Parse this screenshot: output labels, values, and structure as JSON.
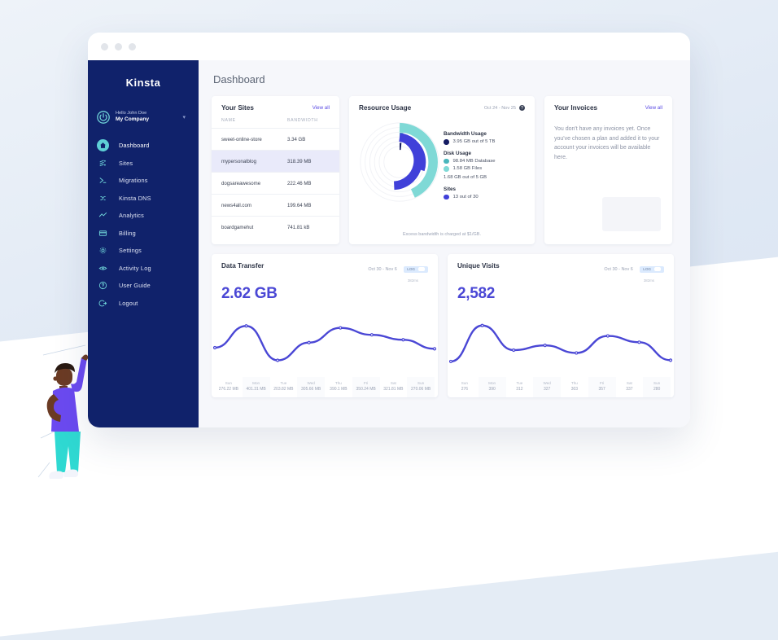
{
  "window": {
    "dots": 3
  },
  "sidebar": {
    "logo": "Kinsta",
    "profile": {
      "hello": "Hello John Doe",
      "company": "My Company",
      "chevron": "chevron-down-icon"
    },
    "items": [
      {
        "label": "Dashboard",
        "icon": "home-icon",
        "active": true
      },
      {
        "label": "Sites",
        "icon": "sites-icon",
        "active": false
      },
      {
        "label": "Migrations",
        "icon": "migrations-icon",
        "active": false
      },
      {
        "label": "Kinsta DNS",
        "icon": "dns-icon",
        "active": false
      },
      {
        "label": "Analytics",
        "icon": "analytics-icon",
        "active": false
      },
      {
        "label": "Billing",
        "icon": "billing-icon",
        "active": false
      },
      {
        "label": "Settings",
        "icon": "gear-icon",
        "active": false
      },
      {
        "label": "Activity Log",
        "icon": "eye-icon",
        "active": false
      },
      {
        "label": "User Guide",
        "icon": "help-icon",
        "active": false
      },
      {
        "label": "Logout",
        "icon": "logout-icon",
        "active": false
      }
    ]
  },
  "header": {
    "title": "Dashboard"
  },
  "sites_card": {
    "title": "Your Sites",
    "view_all": "View all",
    "columns": [
      "NAME",
      "BANDWIDTH"
    ],
    "rows": [
      {
        "name": "sweet-online-store",
        "bandwidth": "3.34 GB",
        "selected": false
      },
      {
        "name": "mypersonalblog",
        "bandwidth": "318.39 MB",
        "selected": true
      },
      {
        "name": "dogsareawesome",
        "bandwidth": "222.46 MB",
        "selected": false
      },
      {
        "name": "news4all.com",
        "bandwidth": "199.64 MB",
        "selected": false
      },
      {
        "name": "boardgamehut",
        "bandwidth": "741.81 kB",
        "selected": false
      }
    ]
  },
  "resource_card": {
    "title": "Resource Usage",
    "date_range": "Oct 24 - Nov 25",
    "info_icon": "question-mark-icon",
    "footer": "Excess bandwidth is charged at $1/GB.",
    "groups": [
      {
        "heading": "Bandwidth Usage",
        "rows": [
          {
            "color": "#151c63",
            "text": "3.95 GB out of 5 TB"
          }
        ],
        "sub": ""
      },
      {
        "heading": "Disk Usage",
        "rows": [
          {
            "color": "#49b6bc",
            "text": "98.84 MB Database"
          },
          {
            "color": "#7fd9d6",
            "text": "1.58 GB Files"
          }
        ],
        "sub": "1.68 GB out of 5 GB"
      },
      {
        "heading": "Sites",
        "rows": [
          {
            "color": "#4040d9",
            "text": "13 out of 30"
          }
        ],
        "sub": ""
      }
    ]
  },
  "chart_data": [
    {
      "type": "line",
      "title": "Data Transfer",
      "total": "2.62 GB",
      "date_range": "Oct 30 - Nov 6",
      "toggle_label": "LOG",
      "latency": "382ms",
      "categories": [
        "Sun",
        "Mon",
        "Tue",
        "Wed",
        "Thu",
        "Fri",
        "Sat",
        "Sun"
      ],
      "tick_labels": [
        "276.22 MB",
        "401.31 MB",
        "203.82 MB",
        "305.66 MB",
        "390.1 MB",
        "350.24 MB",
        "321.81 MB",
        "270.06 MB"
      ],
      "values": [
        276.22,
        401.31,
        203.82,
        305.66,
        390.1,
        350.24,
        321.81,
        270.06
      ],
      "unit": "MB",
      "ylim": [
        150,
        440
      ],
      "grid": false,
      "legend": "none",
      "color": "#4a47d5"
    },
    {
      "type": "line",
      "title": "Unique Visits",
      "total": "2,582",
      "date_range": "Oct 30 - Nov 6",
      "toggle_label": "LOG",
      "latency": "382ms",
      "categories": [
        "Sun",
        "Mon",
        "Tue",
        "Wed",
        "Thu",
        "Fri",
        "Sat",
        "Sun"
      ],
      "tick_labels": [
        "276",
        "390",
        "312",
        "327",
        "303",
        "357",
        "337",
        "280"
      ],
      "values": [
        276,
        390,
        312,
        327,
        303,
        357,
        337,
        280
      ],
      "unit": "visits",
      "ylim": [
        250,
        410
      ],
      "grid": false,
      "legend": "none",
      "color": "#4a47d5"
    }
  ],
  "invoices_card": {
    "title": "Your Invoices",
    "view_all": "View all",
    "body": "You don't have any invoices yet. Once you've chosen a plan and added it to your account your invoices will be available here."
  },
  "colors": {
    "sidebar": "#10226b",
    "accent": "#4a47d5",
    "teal": "#5ecfd6",
    "link": "#5a4ae3"
  }
}
